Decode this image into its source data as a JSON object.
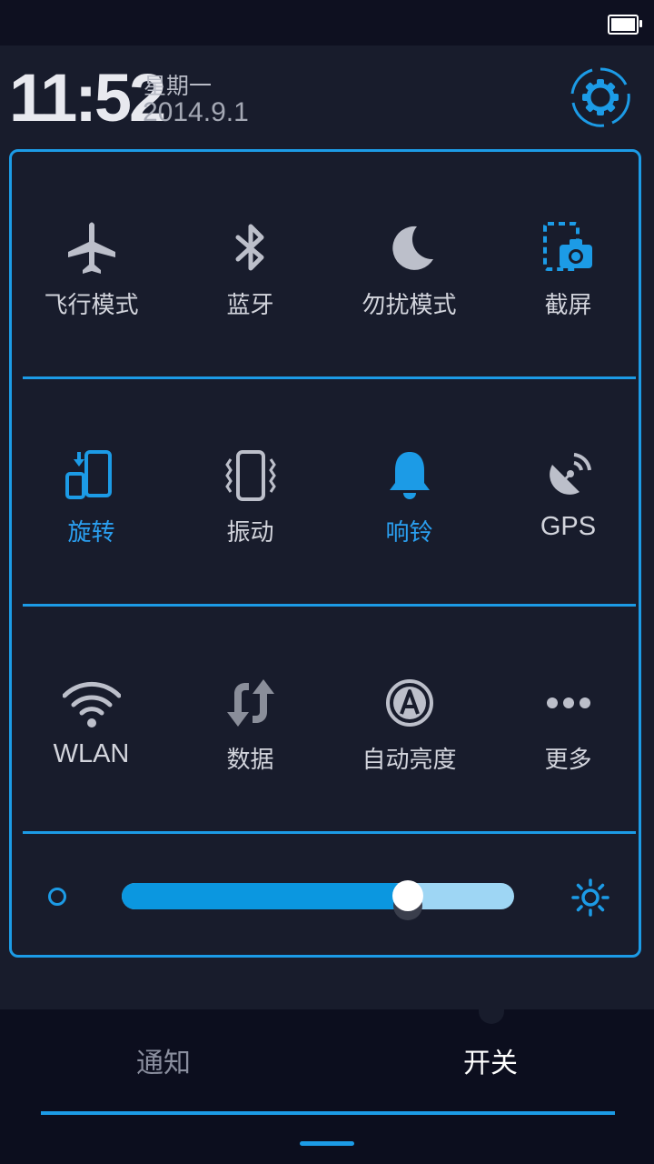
{
  "status_bar": {
    "battery_icon": "battery-full-icon"
  },
  "header": {
    "time": "11:52",
    "weekday": "星期一",
    "date": "2014.9.1",
    "settings_icon": "gear-icon"
  },
  "toggles": [
    [
      {
        "label": "飞行模式",
        "icon": "airplane-icon",
        "active": false
      },
      {
        "label": "蓝牙",
        "icon": "bluetooth-icon",
        "active": false
      },
      {
        "label": "勿扰模式",
        "icon": "moon-icon",
        "active": false
      },
      {
        "label": "截屏",
        "icon": "screenshot-icon",
        "active": true
      }
    ],
    [
      {
        "label": "旋转",
        "icon": "rotate-icon",
        "active": true
      },
      {
        "label": "振动",
        "icon": "vibrate-icon",
        "active": false
      },
      {
        "label": "响铃",
        "icon": "bell-icon",
        "active": true
      },
      {
        "label": "GPS",
        "icon": "gps-icon",
        "active": false
      }
    ],
    [
      {
        "label": "WLAN",
        "icon": "wifi-icon",
        "active": false
      },
      {
        "label": "数据",
        "icon": "data-sync-icon",
        "active": false
      },
      {
        "label": "自动亮度",
        "icon": "auto-brightness-icon",
        "active": false
      },
      {
        "label": "更多",
        "icon": "more-icon",
        "active": false
      }
    ]
  ],
  "brightness": {
    "level_fraction": 0.73,
    "min_icon": "brightness-low-icon",
    "max_icon": "brightness-high-icon"
  },
  "tabs": [
    {
      "label": "通知",
      "selected": false
    },
    {
      "label": "开关",
      "selected": true
    }
  ],
  "colors": {
    "accent": "#1c9be6",
    "background": "#181c2c",
    "bar": "#0c0e1e",
    "inactive_icon": "#bcbfca"
  }
}
